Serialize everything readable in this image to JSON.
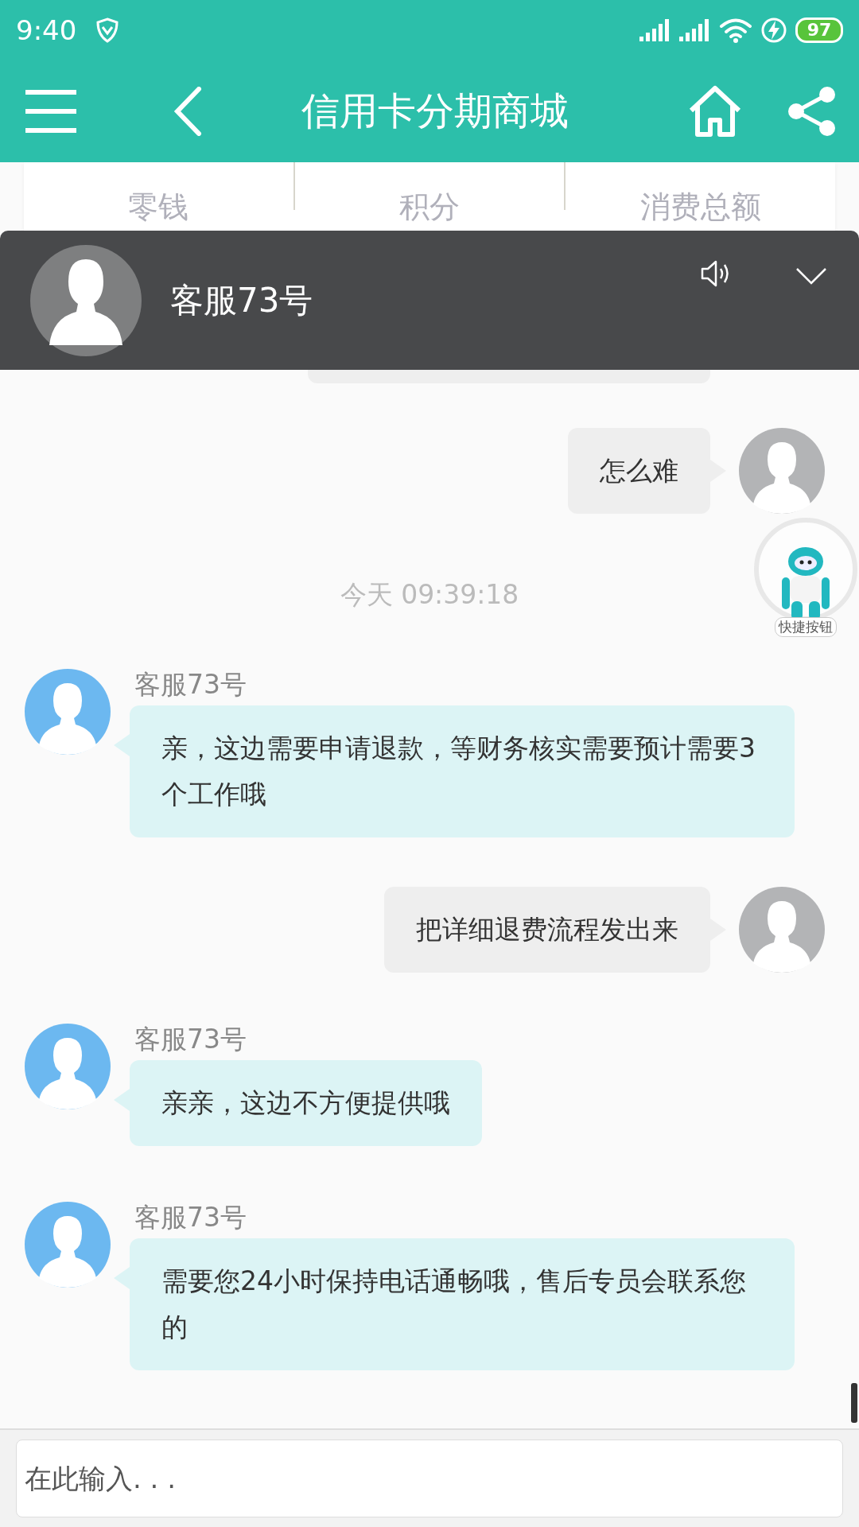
{
  "status_bar": {
    "time": "9:40",
    "battery": "97"
  },
  "header": {
    "title": "信用卡分期商城"
  },
  "stats": [
    "零钱",
    "积分",
    "消费总额"
  ],
  "chat_header": {
    "name": "客服73号"
  },
  "messages": [
    {
      "kind": "hidden"
    },
    {
      "kind": "sent",
      "text": "怎么难"
    },
    {
      "kind": "time",
      "text": "今天 09:39:18"
    },
    {
      "kind": "received",
      "sender": "客服73号",
      "text": "亲，这边需要申请退款，等财务核实需要预计需要3个工作哦"
    },
    {
      "kind": "sent",
      "text": "把详细退费流程发出来"
    },
    {
      "kind": "received",
      "sender": "客服73号",
      "text": "亲亲，这边不方便提供哦"
    },
    {
      "kind": "received",
      "sender": "客服73号",
      "text": "需要您24小时保持电话通畅哦，售后专员会联系您的"
    }
  ],
  "quick_button": {
    "label": "快捷按钮"
  },
  "input": {
    "placeholder": "在此输入. . ."
  }
}
